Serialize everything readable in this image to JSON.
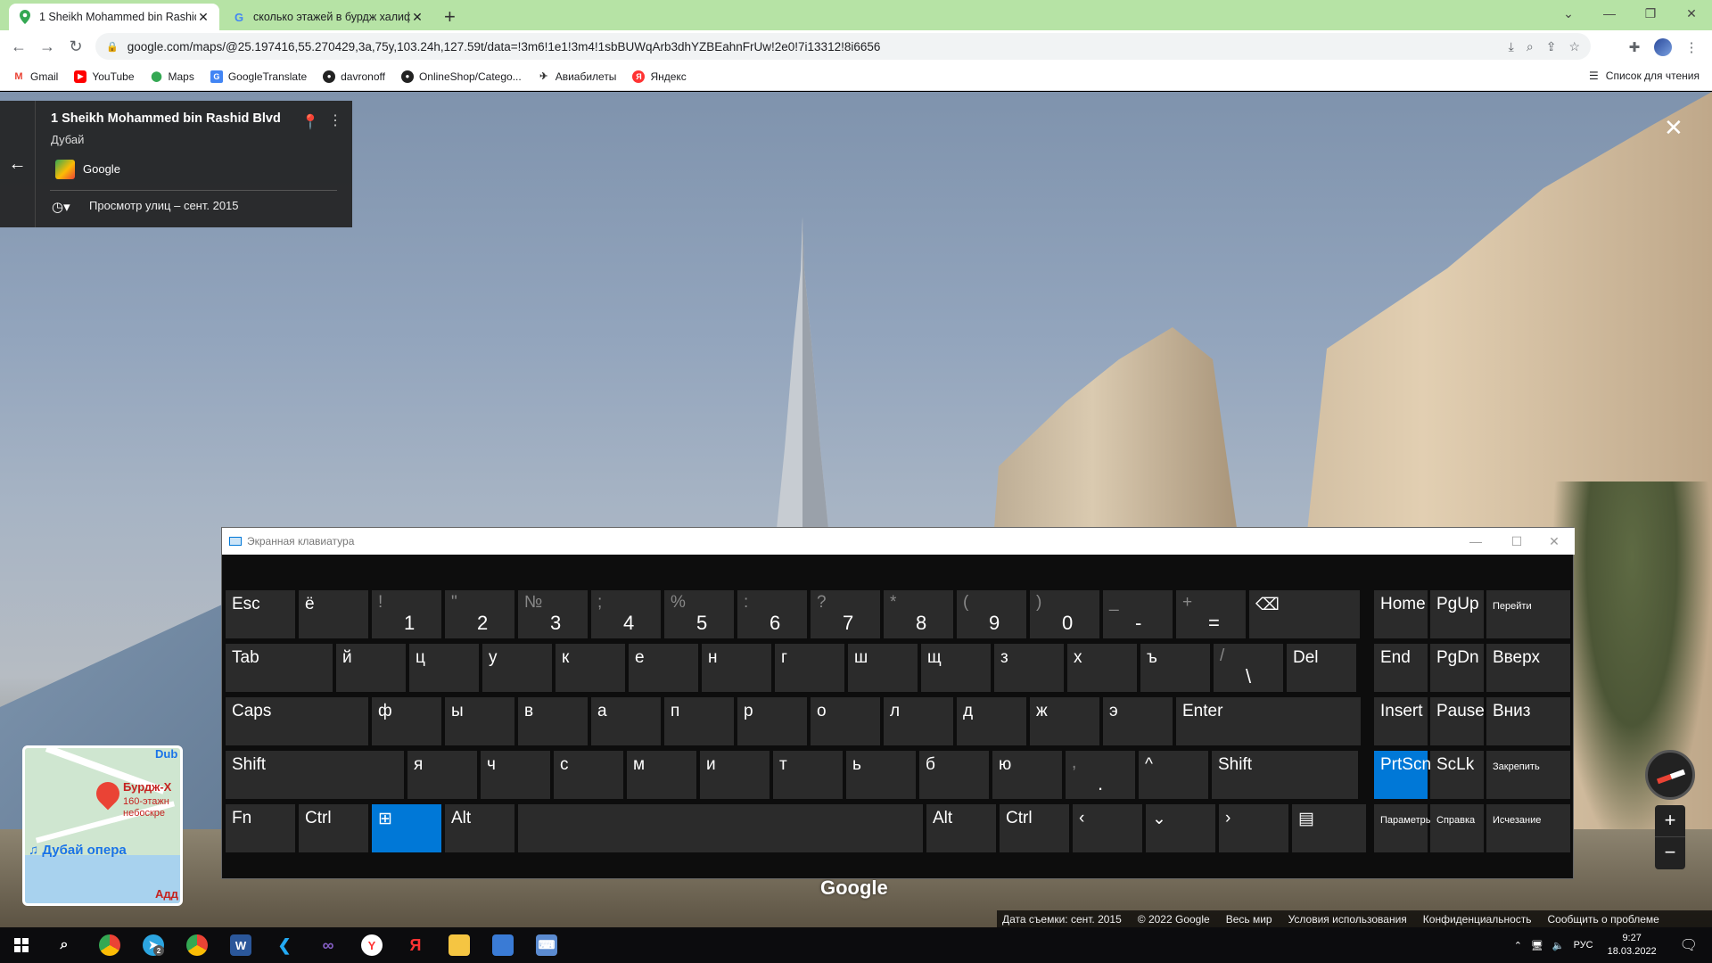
{
  "tabs": [
    {
      "title": "1 Sheikh Mohammed bin Rashid",
      "active": true
    },
    {
      "title": "сколько этажей в бурдж халиф",
      "active": false
    }
  ],
  "address_bar": {
    "url": "google.com/maps/@25.197416,55.270429,3a,75y,103.24h,127.59t/data=!3m6!1e1!3m4!1sbBUWqArb3dhYZBEahnFrUw!2e0!7i13312!8i6656"
  },
  "bookmarks": [
    {
      "label": "Gmail",
      "icon": "gmail-icon"
    },
    {
      "label": "YouTube",
      "icon": "youtube-icon"
    },
    {
      "label": "Maps",
      "icon": "maps-icon"
    },
    {
      "label": "GoogleTranslate",
      "icon": "translate-icon"
    },
    {
      "label": "davronoff",
      "icon": "github-icon"
    },
    {
      "label": "OnlineShop/Catego...",
      "icon": "github-icon"
    },
    {
      "label": "Авиабилеты",
      "icon": "plane-icon"
    },
    {
      "label": "Яндекс",
      "icon": "yandex-icon"
    }
  ],
  "reading_list": "Список для чтения",
  "info_panel": {
    "place": "1 Sheikh Mohammed bin Rashid Blvd",
    "city": "Дубай",
    "provider": "Google",
    "street_view_date": "Просмотр улиц – сент. 2015"
  },
  "minimap": {
    "top_label": "Dub",
    "poi_name": "Бурдж-Х",
    "poi_desc1": "160-этажн",
    "poi_desc2": "небоскре",
    "opera": "Дубай опера",
    "bottom_label": "Адд"
  },
  "watermark": "Google",
  "footer": [
    "Дата съемки: сент. 2015",
    "© 2022 Google",
    "Весь мир",
    "Условия использования",
    "Конфиденциальность",
    "Сообщить о проблеме"
  ],
  "osk": {
    "title": "Экранная клавиатура",
    "rows": {
      "r1": [
        {
          "m": "Esc"
        },
        {
          "m": "ё"
        },
        {
          "t": "!",
          "b": "1"
        },
        {
          "t": "\"",
          "b": "2"
        },
        {
          "t": "№",
          "b": "3"
        },
        {
          "t": ";",
          "b": "4"
        },
        {
          "t": "%",
          "b": "5"
        },
        {
          "t": ":",
          "b": "6"
        },
        {
          "t": "?",
          "b": "7"
        },
        {
          "t": "*",
          "b": "8"
        },
        {
          "t": "(",
          "b": "9"
        },
        {
          "t": ")",
          "b": "0"
        },
        {
          "t": "_",
          "b": "-"
        },
        {
          "t": "+",
          "b": "="
        },
        {
          "m": "⌫"
        }
      ],
      "r2": [
        {
          "m": "Tab"
        },
        {
          "m": "й"
        },
        {
          "m": "ц"
        },
        {
          "m": "у"
        },
        {
          "m": "к"
        },
        {
          "m": "е"
        },
        {
          "m": "н"
        },
        {
          "m": "г"
        },
        {
          "m": "ш"
        },
        {
          "m": "щ"
        },
        {
          "m": "з"
        },
        {
          "m": "х"
        },
        {
          "m": "ъ"
        },
        {
          "t": "/",
          "b": "\\"
        },
        {
          "m": "Del"
        }
      ],
      "r3": [
        {
          "m": "Caps"
        },
        {
          "m": "ф"
        },
        {
          "m": "ы"
        },
        {
          "m": "в"
        },
        {
          "m": "а"
        },
        {
          "m": "п"
        },
        {
          "m": "р"
        },
        {
          "m": "о"
        },
        {
          "m": "л"
        },
        {
          "m": "д"
        },
        {
          "m": "ж"
        },
        {
          "m": "э"
        },
        {
          "m": "Enter"
        }
      ],
      "r4": [
        {
          "m": "Shift"
        },
        {
          "m": "я"
        },
        {
          "m": "ч"
        },
        {
          "m": "с"
        },
        {
          "m": "м"
        },
        {
          "m": "и"
        },
        {
          "m": "т"
        },
        {
          "m": "ь"
        },
        {
          "m": "б"
        },
        {
          "m": "ю"
        },
        {
          "t": ",",
          "b": "."
        },
        {
          "m": "^"
        },
        {
          "m": "Shift"
        }
      ],
      "r5": [
        {
          "m": "Fn"
        },
        {
          "m": "Ctrl"
        },
        {
          "m": "⊞"
        },
        {
          "m": "Alt"
        },
        {
          "m": ""
        },
        {
          "m": "Alt"
        },
        {
          "m": "Ctrl"
        },
        {
          "m": "‹"
        },
        {
          "m": "⌄"
        },
        {
          "m": "›"
        },
        {
          "m": "▤"
        }
      ]
    },
    "side": [
      [
        "Home",
        "PgUp",
        "Перейти"
      ],
      [
        "End",
        "PgDn",
        "Вверх"
      ],
      [
        "Insert",
        "Pause",
        "Вниз"
      ],
      [
        "PrtScn",
        "ScLk",
        "Закрепить"
      ],
      [
        "Параметры",
        "Справка",
        "Исчезание"
      ]
    ]
  },
  "taskbar": {
    "lang": "РУС",
    "time": "9:27",
    "date": "18.03.2022",
    "telegram_badge": "2"
  },
  "colors": {
    "tabstrip": "#b6e3a5",
    "osk_accent": "#0078d7"
  }
}
